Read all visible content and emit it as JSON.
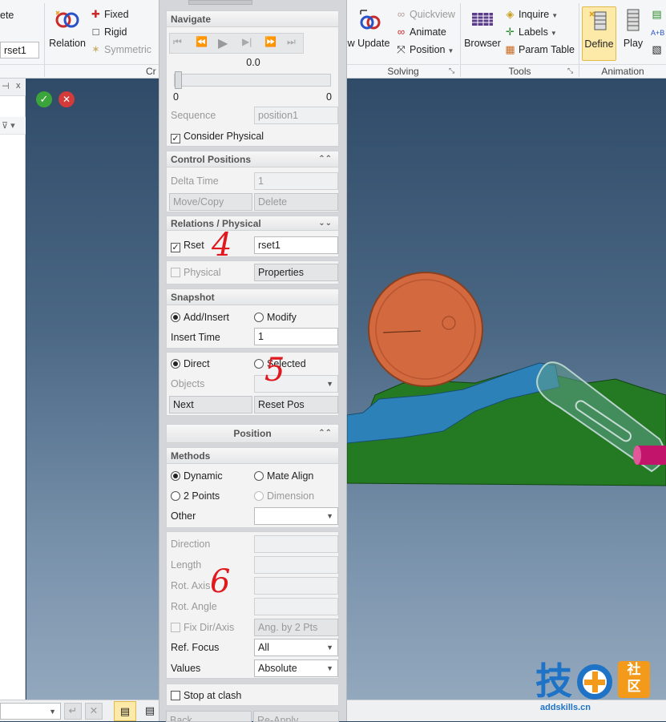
{
  "ribbon": {
    "partial_left": "ete",
    "rset_field": "rset1",
    "relation_label": "Relation",
    "fixed_label": "Fixed",
    "rigid_label": "Rigid",
    "symmetric_label": "Symmetric",
    "create_group_partial": "Cr",
    "update_partial": "w Update",
    "quickview_label": "Quickview",
    "animate_label": "Animate",
    "position_label": "Position",
    "solving_group": "Solving",
    "browser_label": "Browser",
    "inquire_label": "Inquire",
    "labels_label": "Labels",
    "param_table_label": "Param Table",
    "tools_group": "Tools",
    "define_label": "Define",
    "play_label": "Play",
    "animation_group": "Animation"
  },
  "navigate": {
    "header": "Navigate",
    "time_value": "0.0",
    "slider_min": "0",
    "slider_max": "0",
    "sequence_label": "Sequence",
    "sequence_value": "position1",
    "consider_physical_label": "Consider Physical"
  },
  "control_positions": {
    "header": "Control Positions",
    "delta_time_label": "Delta Time",
    "delta_time_value": "1",
    "move_copy_label": "Move/Copy",
    "delete_label": "Delete"
  },
  "relations": {
    "header": "Relations / Physical",
    "rset_label": "Rset",
    "rset_value": "rset1",
    "physical_label": "Physical",
    "properties_label": "Properties"
  },
  "snapshot": {
    "header": "Snapshot",
    "add_insert_label": "Add/Insert",
    "modify_label": "Modify",
    "insert_time_label": "Insert Time",
    "insert_time_value": "1",
    "direct_label": "Direct",
    "selected_label": "Selected",
    "objects_label": "Objects",
    "next_label": "Next",
    "reset_pos_label": "Reset Pos"
  },
  "position": {
    "header": "Position",
    "methods_header": "Methods",
    "dynamic_label": "Dynamic",
    "mate_align_label": "Mate Align",
    "two_points_label": "2 Points",
    "dimension_label": "Dimension",
    "other_label": "Other",
    "direction_label": "Direction",
    "length_label": "Length",
    "rot_axis_label": "Rot. Axis",
    "rot_angle_label": "Rot. Angle",
    "fix_dir_label": "Fix Dir/Axis",
    "ang_by_pts_label": "Ang. by 2 Pts",
    "ref_focus_label": "Ref. Focus",
    "ref_focus_value": "All",
    "values_label": "Values",
    "values_value": "Absolute"
  },
  "stop_at_clash_label": "Stop at clash",
  "bottom_buttons": {
    "back": "Back",
    "re_apply": "Re-Apply"
  },
  "annotations": [
    "4",
    "5",
    "6"
  ],
  "watermark": {
    "chars": "技",
    "badge_top": "社",
    "badge_bottom": "区",
    "url": "addskills.cn"
  },
  "colors": {
    "accent_define": "#fde9a8",
    "annotation": "#e0191f",
    "coin": "#d2693f",
    "green_part": "#1f7a1f",
    "blue_part": "#2b7fb3",
    "magenta_pin": "#c3146b",
    "watermark_blue": "#1f73c6",
    "watermark_orange": "#f39a1b"
  }
}
